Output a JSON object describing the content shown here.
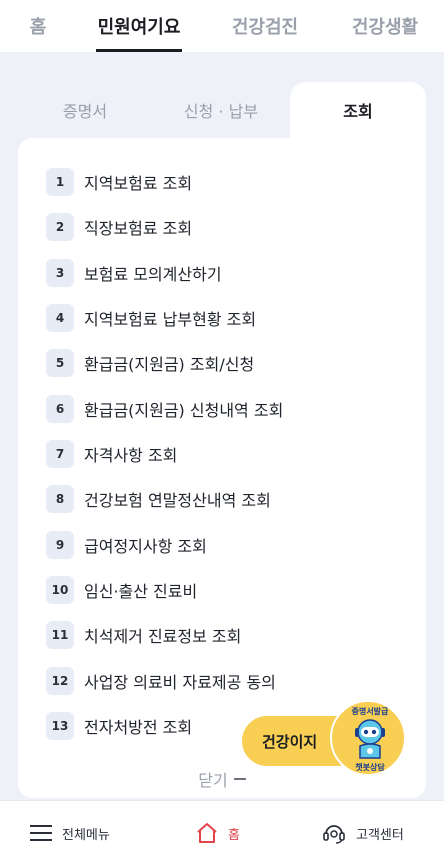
{
  "topnav": {
    "home": "홈",
    "civil": "민원여기요",
    "checkup": "건강검진",
    "life": "건강생활"
  },
  "subtabs": {
    "cert": "증명서",
    "apply": "신청 · 납부",
    "inquiry": "조회"
  },
  "items": [
    {
      "num": "1",
      "label": "지역보험료 조회"
    },
    {
      "num": "2",
      "label": "직장보험료 조회"
    },
    {
      "num": "3",
      "label": "보험료 모의계산하기"
    },
    {
      "num": "4",
      "label": "지역보험료 납부현황 조회"
    },
    {
      "num": "5",
      "label": "환급금(지원금) 조회/신청"
    },
    {
      "num": "6",
      "label": "환급금(지원금) 신청내역 조회"
    },
    {
      "num": "7",
      "label": "자격사항 조회"
    },
    {
      "num": "8",
      "label": "건강보험 연말정산내역 조회"
    },
    {
      "num": "9",
      "label": "급여정지사항 조회"
    },
    {
      "num": "10",
      "label": "임신·출산 진료비"
    },
    {
      "num": "11",
      "label": "치석제거 진료정보 조회"
    },
    {
      "num": "12",
      "label": "사업장 의료비 자료제공 동의"
    },
    {
      "num": "13",
      "label": "전자처방전 조회"
    }
  ],
  "close_label": "닫기",
  "chatbot": {
    "pill": "건강이지",
    "badge_top": "증명서발급",
    "badge_bottom": "챗봇상담"
  },
  "bottombar": {
    "menu": "전체메뉴",
    "home": "홈",
    "cs": "고객센터"
  },
  "colors": {
    "accent_home": "#e2444a",
    "chatbot_yellow": "#f8cf52",
    "number_badge_bg": "#e8ecf6"
  }
}
